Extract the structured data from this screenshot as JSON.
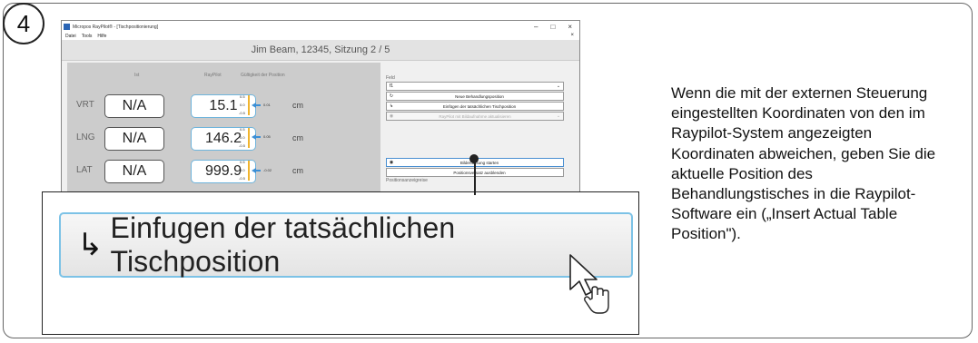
{
  "step": {
    "number": "4"
  },
  "window": {
    "title": "Micropos RayPilot® - [Tischpositionierung]",
    "controls": [
      "–",
      "□",
      "×"
    ],
    "menu": [
      "Datei",
      "Tools",
      "Hilfe"
    ],
    "menu_close": "×"
  },
  "patient_bar": "Jim Beam, 12345, Sitzung 2 / 5",
  "columns": {
    "ist": "Ist",
    "raypilot": "RayPilot",
    "validity": "Gültigkeit der Position"
  },
  "rows": [
    {
      "axis": "VRT",
      "ist": "N/A",
      "raypilot": "15.1",
      "scale_top": "0.5",
      "scale_mid": "0.0",
      "scale_bot": "-0.5",
      "current": "0.01",
      "unit": "cm",
      "offset": 0.01
    },
    {
      "axis": "LNG",
      "ist": "N/A",
      "raypilot": "146.2",
      "scale_top": "0.5",
      "scale_mid": "0.0",
      "scale_bot": "-0.5",
      "current": "0.05",
      "unit": "cm",
      "offset": 0.05
    },
    {
      "axis": "LAT",
      "ist": "N/A",
      "raypilot": "999.9",
      "scale_top": "0.5",
      "scale_mid": "0.0",
      "scale_bot": "-0.5",
      "current": "-0.02",
      "unit": "cm",
      "offset": -0.02
    }
  ],
  "right_panel": {
    "field_label": "Feld",
    "field_value": "f1",
    "buttons": {
      "new_position": "Neue Behandlungsposition",
      "insert_actual": "Einfügen der tatsächlichen Tischposition",
      "disabled_text": "RayPilot mit Bildaufnahme aktualisieren",
      "start_capture": "Bilderfassung starten",
      "hide_position": "Positionsversatz ausblenden"
    },
    "group_label": "Positionsanzeigreise"
  },
  "zoom": {
    "label": "Einfugen der tatsächlichen Tischposition"
  },
  "description": "Wenn die mit der externen Steuerung eingestellten Koordinaten von den im Raypilot-System angezeigten Koordinaten abweichen, geben Sie die aktuelle Position des Behandlungstisches in die Raypilot-Software ein („Insert Actual Table Position\")."
}
